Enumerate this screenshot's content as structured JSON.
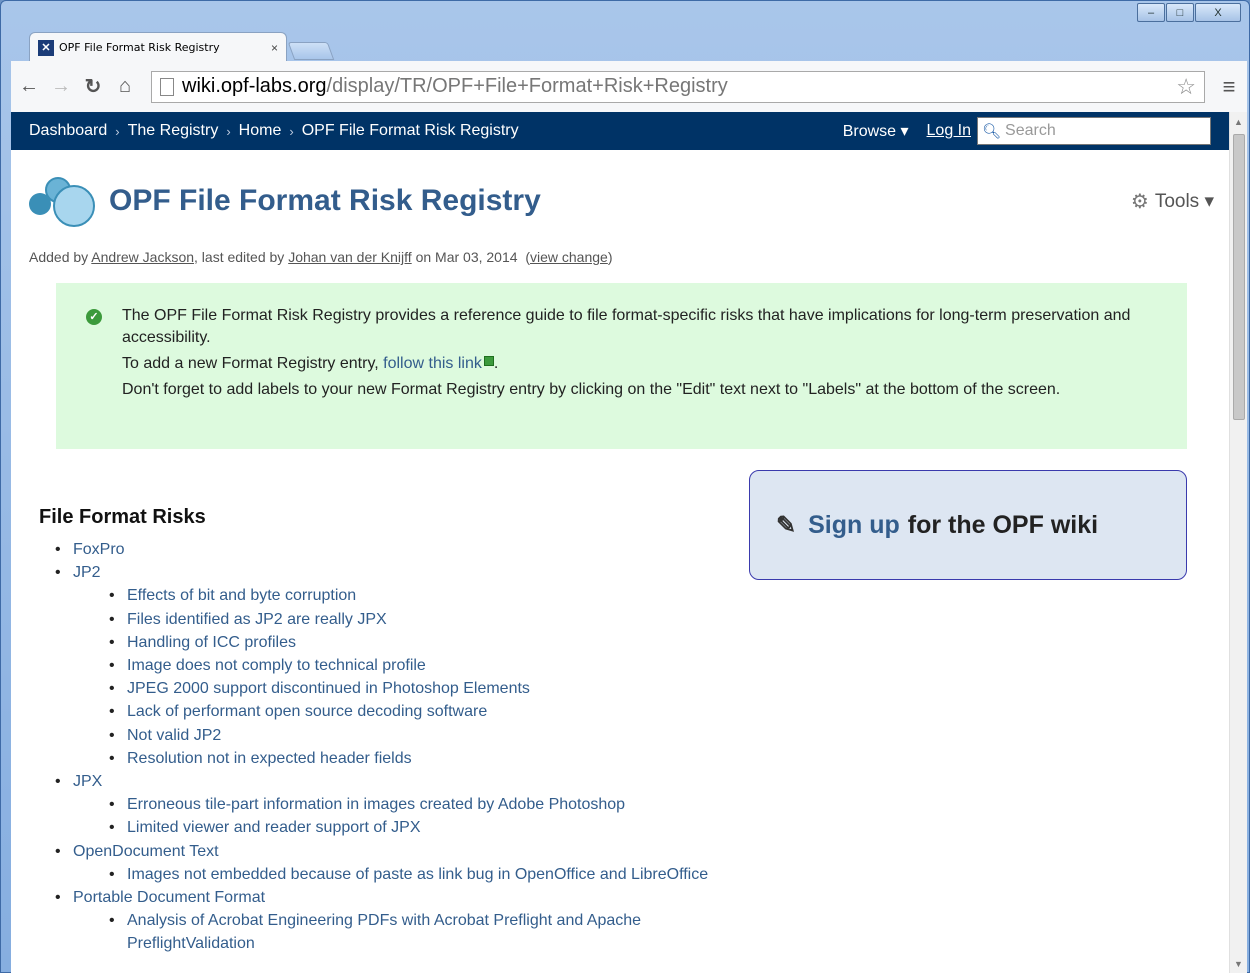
{
  "browser": {
    "tab_title": "OPF File Format Risk Registry",
    "tab_close": "×",
    "url_host": "wiki.opf-labs.org",
    "url_path": "/display/TR/OPF+File+Format+Risk+Registry",
    "win_minimize": "–",
    "win_maximize": "□",
    "win_close": "X"
  },
  "header": {
    "breadcrumbs": [
      "Dashboard",
      "The Registry",
      "Home",
      "OPF File Format Risk Registry"
    ],
    "crumb_separator": "›",
    "browse_label": "Browse ▾",
    "login_label": "Log In",
    "search_placeholder": "Search"
  },
  "page": {
    "title": "OPF File Format Risk Registry",
    "tools_label": "Tools ▾",
    "meta": {
      "added_by_prefix": "Added by",
      "added_by": "Andrew Jackson",
      "edited_prefix": ", last edited by",
      "edited_by": "Johan van der Knijff",
      "date": "on Mar 03, 2014",
      "view_change": "view change"
    },
    "info": {
      "line1": "The OPF File Format Risk Registry provides a reference guide to file format-specific risks that have implications for long-term preservation and accessibility.",
      "line2_prefix": "To add a new Format Registry entry,",
      "line2_link": "follow this link",
      "line3": "Don't forget to add labels to your new Format Registry entry by clicking on the \"Edit\" text next to \"Labels\" at the bottom of the screen."
    },
    "signup": {
      "link": "Sign up",
      "rest": "for the OPF wiki"
    },
    "risks_heading": "File Format Risks",
    "formats": [
      {
        "name": "FoxPro",
        "risks": []
      },
      {
        "name": "JP2",
        "risks": [
          "Effects of bit and byte corruption",
          "Files identified as JP2 are really JPX",
          "Handling of ICC profiles",
          "Image does not comply to technical profile",
          "JPEG 2000 support discontinued in Photoshop Elements",
          "Lack of performant open source decoding software",
          "Not valid JP2",
          "Resolution not in expected header fields"
        ]
      },
      {
        "name": "JPX",
        "risks": [
          "Erroneous tile-part information in images created by Adobe Photoshop",
          "Limited viewer and reader support of JPX"
        ]
      },
      {
        "name": "OpenDocument Text",
        "risks": [
          "Images not embedded because of paste as link bug in OpenOffice and LibreOffice"
        ]
      },
      {
        "name": "Portable Document Format",
        "risks": [
          "Analysis of Acrobat Engineering PDFs with Acrobat Preflight and Apache PreflightValidation"
        ]
      }
    ]
  }
}
